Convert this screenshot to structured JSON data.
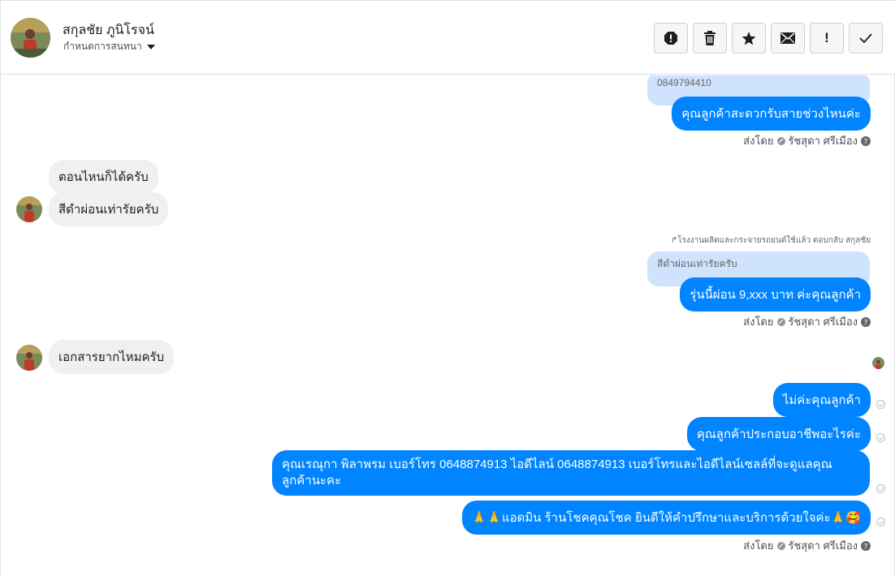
{
  "header": {
    "contact_name": "สกุลชัย ภูนิโรจน์",
    "assign_label": "กำหนดการสนทนา",
    "toolbar": [
      "spam-icon",
      "trash-icon",
      "star-icon",
      "mail-icon",
      "exclamation-icon",
      "check-icon"
    ],
    "exclamation_glyph": "!"
  },
  "messages": {
    "reply1_quote": "0849794410",
    "out1": "คุณลูกค้าสะดวกรับสายช่วงไหนค่ะ",
    "sent_by_label": "ส่งโดย",
    "sent_by_name": "รัชสุดา ศรีเมือง",
    "in1": "ตอนไหนก็ได้ครับ",
    "in2": "สีดำผ่อนเท่ารัยครับ",
    "reply_note": "โรงงานผลิตและกระจายรถยนต์ใช้แล้ว ตอบกลับ สกุลชัย",
    "reply2_quote": "สีดำผ่อนเท่ารัยครับ",
    "out2": "รุ่นนี้ผ่อน  9,xxx บาท  ค่ะคุณลูกค้า",
    "in3": "เอกสารยากไหมครับ",
    "out3": "ไม่ค่ะคุณลูกค้า",
    "out4": "คุณลูกค้าประกอบอาชีพอะไรค่ะ",
    "out5": "คุณเรณุกา พิลาพรม        เบอร์โทร 0648874913  ไอดีไลน์ 0648874913   เบอร์โทรและไอดีไลน์เซลล์ที่จะดูแลคุณลูกค้านะคะ",
    "out6_prefix": "🙏🙏",
    "out6": "แอดมิน ร้านโชคคุณโชค ยินดีให้คำปรึกษาและบริการด้วยใจค่ะ",
    "out6_suffix": "🙏🥰"
  },
  "colors": {
    "outgoing": "#0084ff",
    "incoming": "#f1f0f0",
    "reply_quote": "#cfe3fc"
  }
}
